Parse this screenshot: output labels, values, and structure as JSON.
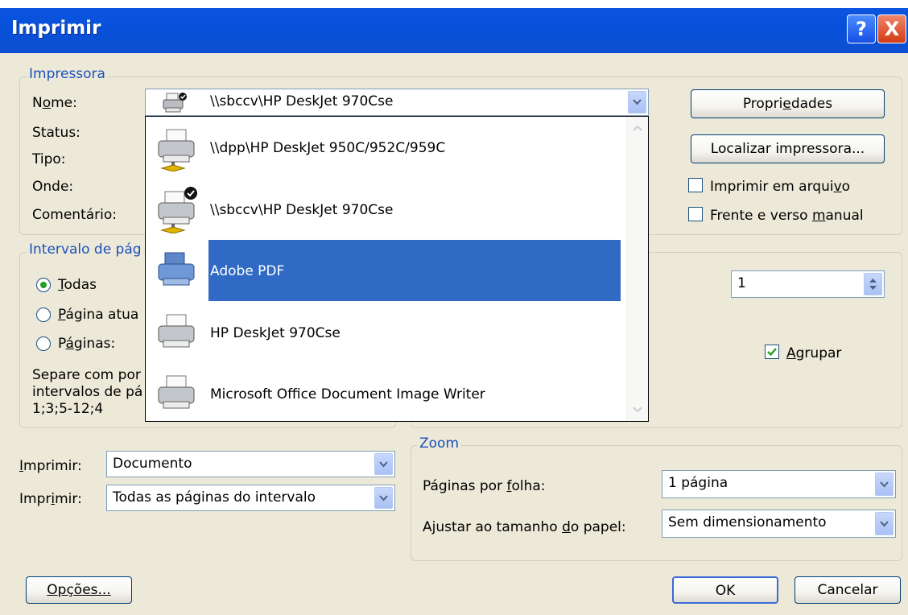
{
  "window": {
    "title": "Imprimir",
    "help_glyph": "?",
    "close_glyph": "X"
  },
  "printer": {
    "legend": "Impressora",
    "name_label_a": "N",
    "name_label_u": "o",
    "name_label_b": "me:",
    "status_label": "Status:",
    "type_label": "Tipo:",
    "where_label": "Onde:",
    "comment_label": "Comentário:",
    "selected_printer": "\\\\sbccv\\HP DeskJet 970Cse",
    "properties_a": "Propri",
    "properties_u": "e",
    "properties_b": "dades",
    "find_printer": "Localizar impressora...",
    "print_to_file_a": "Imprimir em arqui",
    "print_to_file_u": "v",
    "print_to_file_b": "o",
    "manual_duplex_a": "Frente e verso ",
    "manual_duplex_u": "m",
    "manual_duplex_b": "anual",
    "print_to_file_checked": false,
    "manual_duplex_checked": false
  },
  "dropdown": {
    "items": [
      {
        "label": "\\\\dpp\\HP DeskJet 950C/952C/959C",
        "icon": "network-printer-icon",
        "selected": false
      },
      {
        "label": "\\\\sbccv\\HP DeskJet 970Cse",
        "icon": "default-network-printer-icon",
        "selected": false
      },
      {
        "label": "Adobe PDF",
        "icon": "pdf-printer-icon",
        "selected": true
      },
      {
        "label": "HP DeskJet 970Cse",
        "icon": "printer-icon",
        "selected": false
      },
      {
        "label": "Microsoft Office Document Image Writer",
        "icon": "printer-icon",
        "selected": false
      }
    ]
  },
  "range": {
    "legend": "Intervalo de pág",
    "all_u": "T",
    "all_b": "odas",
    "current_u": "P",
    "current_b": "ágina atua",
    "pages_a": "P",
    "pages_u": "á",
    "pages_b": "ginas:",
    "hint_1": "Separe com por",
    "hint_2": "intervalos de pá",
    "hint_3": "1;3;5-12;4",
    "selected": "all"
  },
  "copies": {
    "count": "1",
    "collate_u": "A",
    "collate_b": "grupar",
    "collate_checked": true
  },
  "print_what": {
    "label_u": "I",
    "label_b": "mprimir:",
    "value": "Documento"
  },
  "print_pages": {
    "label_a": "Impr",
    "label_u": "i",
    "label_b": "mir:",
    "value": "Todas as páginas do intervalo"
  },
  "zoom": {
    "legend": "Zoom",
    "pages_per_sheet_a": "Páginas por ",
    "pages_per_sheet_u": "f",
    "pages_per_sheet_b": "olha:",
    "pages_per_sheet_value": "1 página",
    "scale_a": "Ajustar ao tamanho ",
    "scale_u": "d",
    "scale_b": "o papel:",
    "scale_value": "Sem dimensionamento"
  },
  "footer": {
    "options_a": "O",
    "options_u": "p",
    "options_b": "ções...",
    "ok": "OK",
    "cancel": "Cancelar"
  },
  "colors": {
    "titlebar": "#0850da",
    "face": "#ece9d8",
    "selection": "#316ac5",
    "groupbox_label": "#1d4fbd"
  }
}
